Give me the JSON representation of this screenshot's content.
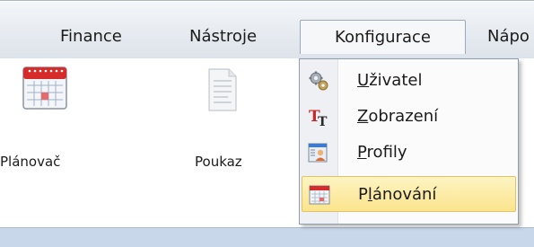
{
  "menubar": {
    "items": [
      {
        "label": "Finance"
      },
      {
        "label": "Nástroje"
      },
      {
        "label": "Konfigurace"
      },
      {
        "label": "Nápo"
      }
    ]
  },
  "ribbon": {
    "buttons": [
      {
        "label": "Plánovač",
        "icon": "calendar-icon"
      },
      {
        "label": "Poukaz",
        "icon": "document-icon"
      }
    ]
  },
  "dropdown": {
    "items": [
      {
        "accel": "U",
        "rest": "živatel",
        "icon": "gears-icon"
      },
      {
        "accel": "Z",
        "rest": "obrazení",
        "icon": "font-icon"
      },
      {
        "accel": "P",
        "rest": "rofily",
        "icon": "profile-icon"
      },
      {
        "pre": "P",
        "accel": "l",
        "rest": "ánování",
        "icon": "calendar-icon",
        "selected": true
      }
    ]
  },
  "colors": {
    "accent_highlight": "#fbe48c",
    "menubar": "#e9edf2",
    "status_bar": "#c8d8ea"
  }
}
